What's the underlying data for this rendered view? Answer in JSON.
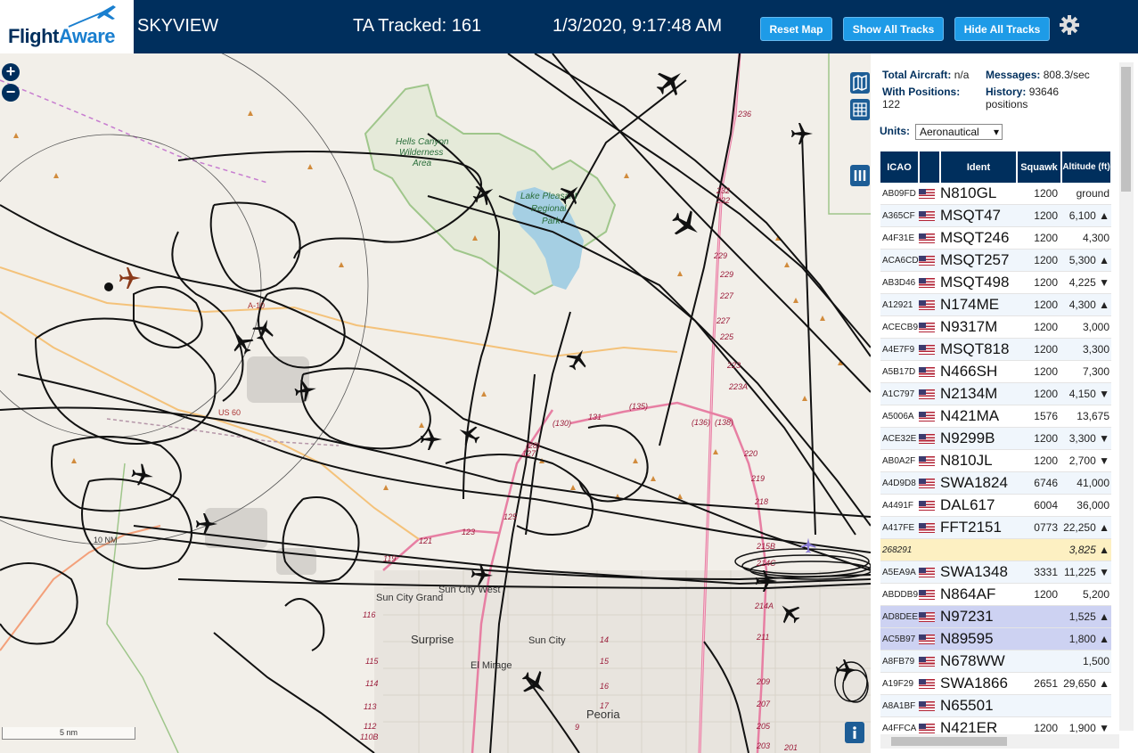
{
  "header": {
    "logo_part1": "Flight",
    "logo_part2": "Aware",
    "app_name": "SKYVIEW",
    "tracked": "TA Tracked: 161",
    "datetime": "1/3/2020, 9:17:48 AM",
    "buttons": {
      "reset": "Reset Map",
      "show": "Show All Tracks",
      "hide": "Hide All Tracks"
    }
  },
  "map": {
    "labels": [
      "Hells Canyon",
      "Wilderness",
      "Area",
      "Lake Pleasant",
      "Regional",
      "Park",
      "Sun City Grand",
      "Sun City West",
      "Surprise",
      "Sun City",
      "El Mirage",
      "Peoria",
      "10 NM",
      "US 60",
      "A-10"
    ],
    "route_numbers": [
      "236",
      "232",
      "232",
      "229",
      "229",
      "227",
      "227",
      "225",
      "223",
      "223A",
      "(136)",
      "(138)",
      "(130)",
      "131",
      "(135)",
      "(28)",
      "127",
      "125",
      "123",
      "121",
      "119",
      "116",
      "115",
      "114",
      "113",
      "112",
      "110B",
      "14",
      "15",
      "16",
      "17",
      "9",
      "220",
      "219",
      "218",
      "215B",
      "214C",
      "214A",
      "211",
      "209",
      "207",
      "205",
      "203",
      "201"
    ],
    "scale_label": "5 nm"
  },
  "stats": {
    "total_label": "Total Aircraft:",
    "total_value": "n/a",
    "messages_label": "Messages:",
    "messages_value": "808.3/sec",
    "positions_label": "With Positions:",
    "positions_value": "122",
    "history_label": "History:",
    "history_value": "93646 positions"
  },
  "units": {
    "label": "Units:",
    "selected": "Aeronautical"
  },
  "table": {
    "headers": {
      "icao": "ICAO",
      "ident": "Ident",
      "squawk": "Squawk",
      "altitude": "Altitude (ft)"
    },
    "rows": [
      {
        "icao": "AB09FD",
        "ident": "N810GL",
        "squawk": "1200",
        "alt": "ground"
      },
      {
        "icao": "A365CF",
        "ident": "MSQT47",
        "squawk": "1200",
        "alt": "6,100 ▲"
      },
      {
        "icao": "A4F31E",
        "ident": "MSQT246",
        "squawk": "1200",
        "alt": "4,300"
      },
      {
        "icao": "ACA6CD",
        "ident": "MSQT257",
        "squawk": "1200",
        "alt": "5,300 ▲"
      },
      {
        "icao": "AB3D46",
        "ident": "MSQT498",
        "squawk": "1200",
        "alt": "4,225 ▼"
      },
      {
        "icao": "A12921",
        "ident": "N174ME",
        "squawk": "1200",
        "alt": "4,300 ▲"
      },
      {
        "icao": "ACECB9",
        "ident": "N9317M",
        "squawk": "1200",
        "alt": "3,000"
      },
      {
        "icao": "A4E7F9",
        "ident": "MSQT818",
        "squawk": "1200",
        "alt": "3,300"
      },
      {
        "icao": "A5B17D",
        "ident": "N466SH",
        "squawk": "1200",
        "alt": "7,300"
      },
      {
        "icao": "A1C797",
        "ident": "N2134M",
        "squawk": "1200",
        "alt": "4,150 ▼"
      },
      {
        "icao": "A5006A",
        "ident": "N421MA",
        "squawk": "1576",
        "alt": "13,675"
      },
      {
        "icao": "ACE32E",
        "ident": "N9299B",
        "squawk": "1200",
        "alt": "3,300 ▼"
      },
      {
        "icao": "AB0A2F",
        "ident": "N810JL",
        "squawk": "1200",
        "alt": "2,700 ▼"
      },
      {
        "icao": "A4D9D8",
        "ident": "SWA1824",
        "squawk": "6746",
        "alt": "41,000"
      },
      {
        "icao": "A4491F",
        "ident": "DAL617",
        "squawk": "6004",
        "alt": "36,000"
      },
      {
        "icao": "A417FE",
        "ident": "FFT2151",
        "squawk": "0773",
        "alt": "22,250 ▲"
      },
      {
        "icao": "268291",
        "ident": "",
        "squawk": "",
        "alt": "3,825 ▲"
      },
      {
        "icao": "A5EA9A",
        "ident": "SWA1348",
        "squawk": "3331",
        "alt": "11,225 ▼"
      },
      {
        "icao": "ABDDB9",
        "ident": "N864AF",
        "squawk": "1200",
        "alt": "5,200"
      },
      {
        "icao": "AD8DEE",
        "ident": "N97231",
        "squawk": "",
        "alt": "1,525 ▲"
      },
      {
        "icao": "AC5B97",
        "ident": "N89595",
        "squawk": "",
        "alt": "1,800 ▲"
      },
      {
        "icao": "A8FB79",
        "ident": "N678WW",
        "squawk": "",
        "alt": "1,500"
      },
      {
        "icao": "A19F29",
        "ident": "SWA1866",
        "squawk": "2651",
        "alt": "29,650 ▲"
      },
      {
        "icao": "A8A1BF",
        "ident": "N65501",
        "squawk": "",
        "alt": ""
      },
      {
        "icao": "A4FFCA",
        "ident": "N421ER",
        "squawk": "1200",
        "alt": "1,900 ▼"
      }
    ]
  }
}
